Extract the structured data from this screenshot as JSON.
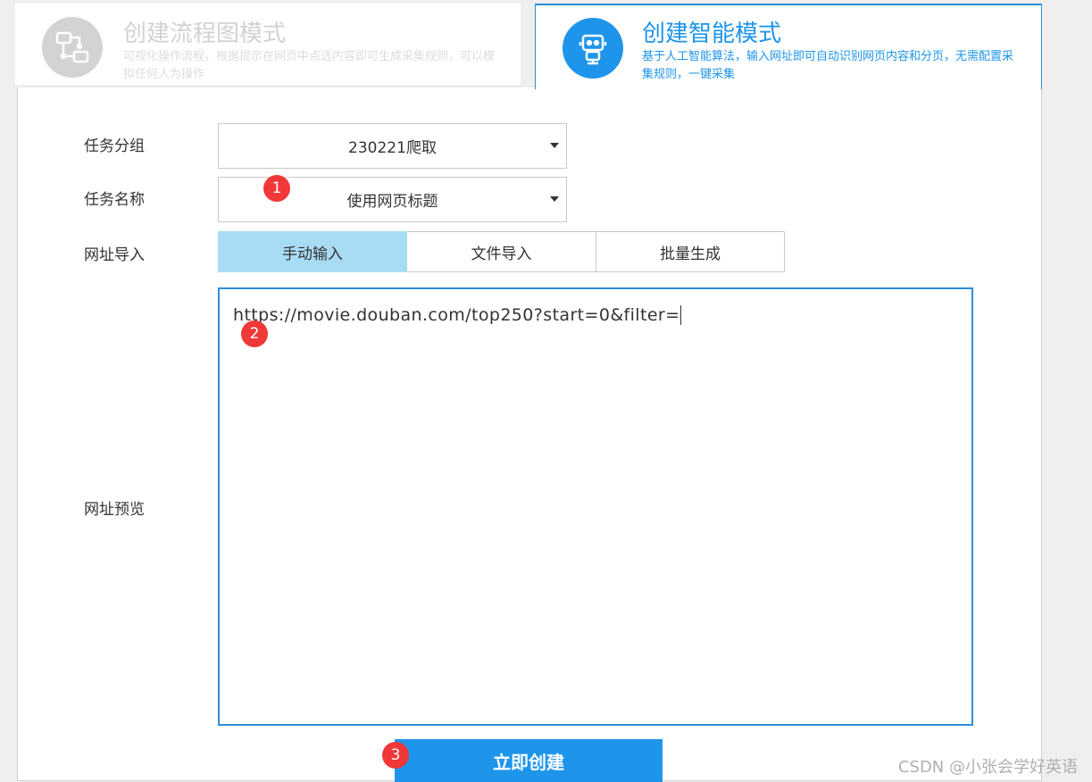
{
  "mode_tabs": {
    "flow": {
      "title": "创建流程图模式",
      "description": "可视化操作流程，根据提示在网页中点选内容即可生成采集规则，可以模拟任何人为操作",
      "icon": "flowchart-icon"
    },
    "smart": {
      "title": "创建智能模式",
      "description": "基于人工智能算法，输入网址即可自动识别网页内容和分页，无需配置采集规则，一键采集",
      "icon": "robot-icon"
    }
  },
  "form": {
    "task_group_label": "任务分组",
    "task_group_value": "230221爬取",
    "task_name_label": "任务名称",
    "task_name_value": "使用网页标题",
    "url_import_label": "网址导入",
    "url_import_options": [
      "手动输入",
      "文件导入",
      "批量生成"
    ],
    "url_import_selected": "手动输入",
    "url_preview_label": "网址预览",
    "url_value": "https://movie.douban.com/top250?start=0&filter="
  },
  "create_button_label": "立即创建",
  "badges": [
    "1",
    "2",
    "3"
  ],
  "watermark": "CSDN @小张会学好英语",
  "colors": {
    "accent": "#1e95ea",
    "active_segment": "#a8dcf5",
    "badge": "#f03838",
    "inactive": "#d3d3d3"
  }
}
